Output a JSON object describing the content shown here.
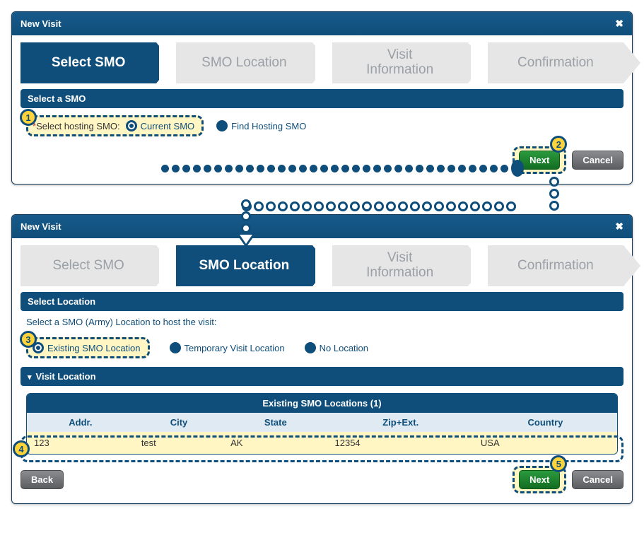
{
  "window1": {
    "title": "New Visit",
    "steps": [
      "Select SMO",
      "SMO Location",
      "Visit Information",
      "Confirmation"
    ],
    "active_step": 0,
    "section": "Select a SMO",
    "field_label": "Select hosting SMO:",
    "options": [
      {
        "label": "Current SMO",
        "selected": true
      },
      {
        "label": "Find Hosting SMO",
        "selected": false
      }
    ],
    "next": "Next",
    "cancel": "Cancel"
  },
  "window2": {
    "title": "New Visit",
    "steps": [
      "Select SMO",
      "SMO Location",
      "Visit Information",
      "Confirmation"
    ],
    "active_step": 1,
    "section1": "Select Location",
    "instruction": "Select a SMO (Army) Location to host the visit:",
    "options": [
      {
        "label": "Existing SMO Location",
        "selected": true
      },
      {
        "label": "Temporary Visit Location",
        "selected": false
      },
      {
        "label": "No Location",
        "selected": false
      }
    ],
    "section2": "Visit Location",
    "table": {
      "title": "Existing SMO Locations (1)",
      "headers": [
        "Addr.",
        "City",
        "State",
        "Zip+Ext.",
        "Country"
      ],
      "rows": [
        {
          "addr": "123",
          "city": "test",
          "state": "AK",
          "zip": "12354",
          "country": "USA"
        }
      ]
    },
    "back": "Back",
    "next": "Next",
    "cancel": "Cancel"
  },
  "callouts": {
    "c1": "1",
    "c2": "2",
    "c3": "3",
    "c4": "4",
    "c5": "5"
  }
}
